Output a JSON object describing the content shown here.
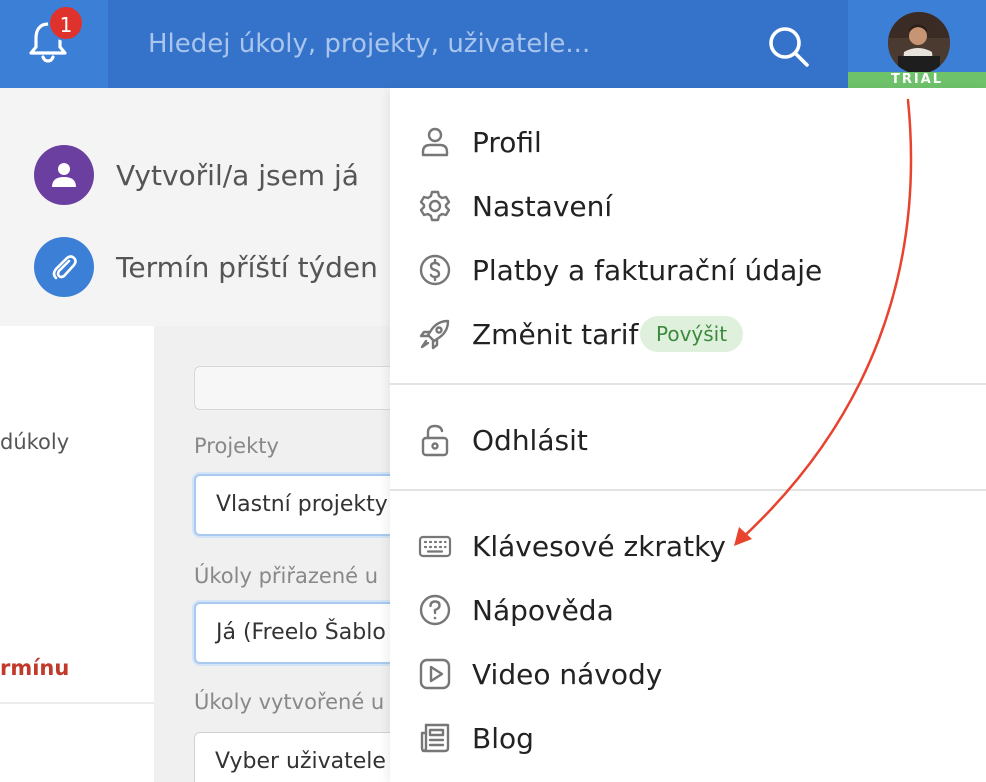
{
  "header": {
    "notifications_count": "1",
    "search_placeholder": "Hledej úkoly, projekty, uživatele...",
    "trial_label": "TRIAL"
  },
  "filters": [
    {
      "label": "Vytvořil/a jsem já",
      "icon": "user-icon",
      "color": "#6b3fa0"
    },
    {
      "label": "Termín příští týden",
      "icon": "paperclip-icon",
      "color": "#3c7fd6"
    }
  ],
  "left_column": {
    "item_subtasks": "dúkoly",
    "item_no_deadline": "rmínu"
  },
  "form": {
    "projects_label": "Projekty",
    "projects_value": "Vlastní projekty",
    "assigned_label": "Úkoly přiřazené u",
    "assigned_value": "Já (Freelo Šablo",
    "created_label": "Úkoly vytvořené u",
    "created_value": "Vyber uživatele"
  },
  "menu": {
    "profile": "Profil",
    "settings": "Nastavení",
    "billing": "Platby a fakturační údaje",
    "change_plan": "Změnit tarif",
    "upgrade_badge": "Povýšit",
    "logout": "Odhlásit",
    "shortcuts": "Klávesové zkratky",
    "help": "Nápověda",
    "video": "Video návody",
    "blog": "Blog"
  },
  "colors": {
    "topbar": "#3473c9",
    "accent_red": "#e0322c",
    "trial_green": "#6ec26a",
    "annotation_arrow": "#e8432e"
  }
}
